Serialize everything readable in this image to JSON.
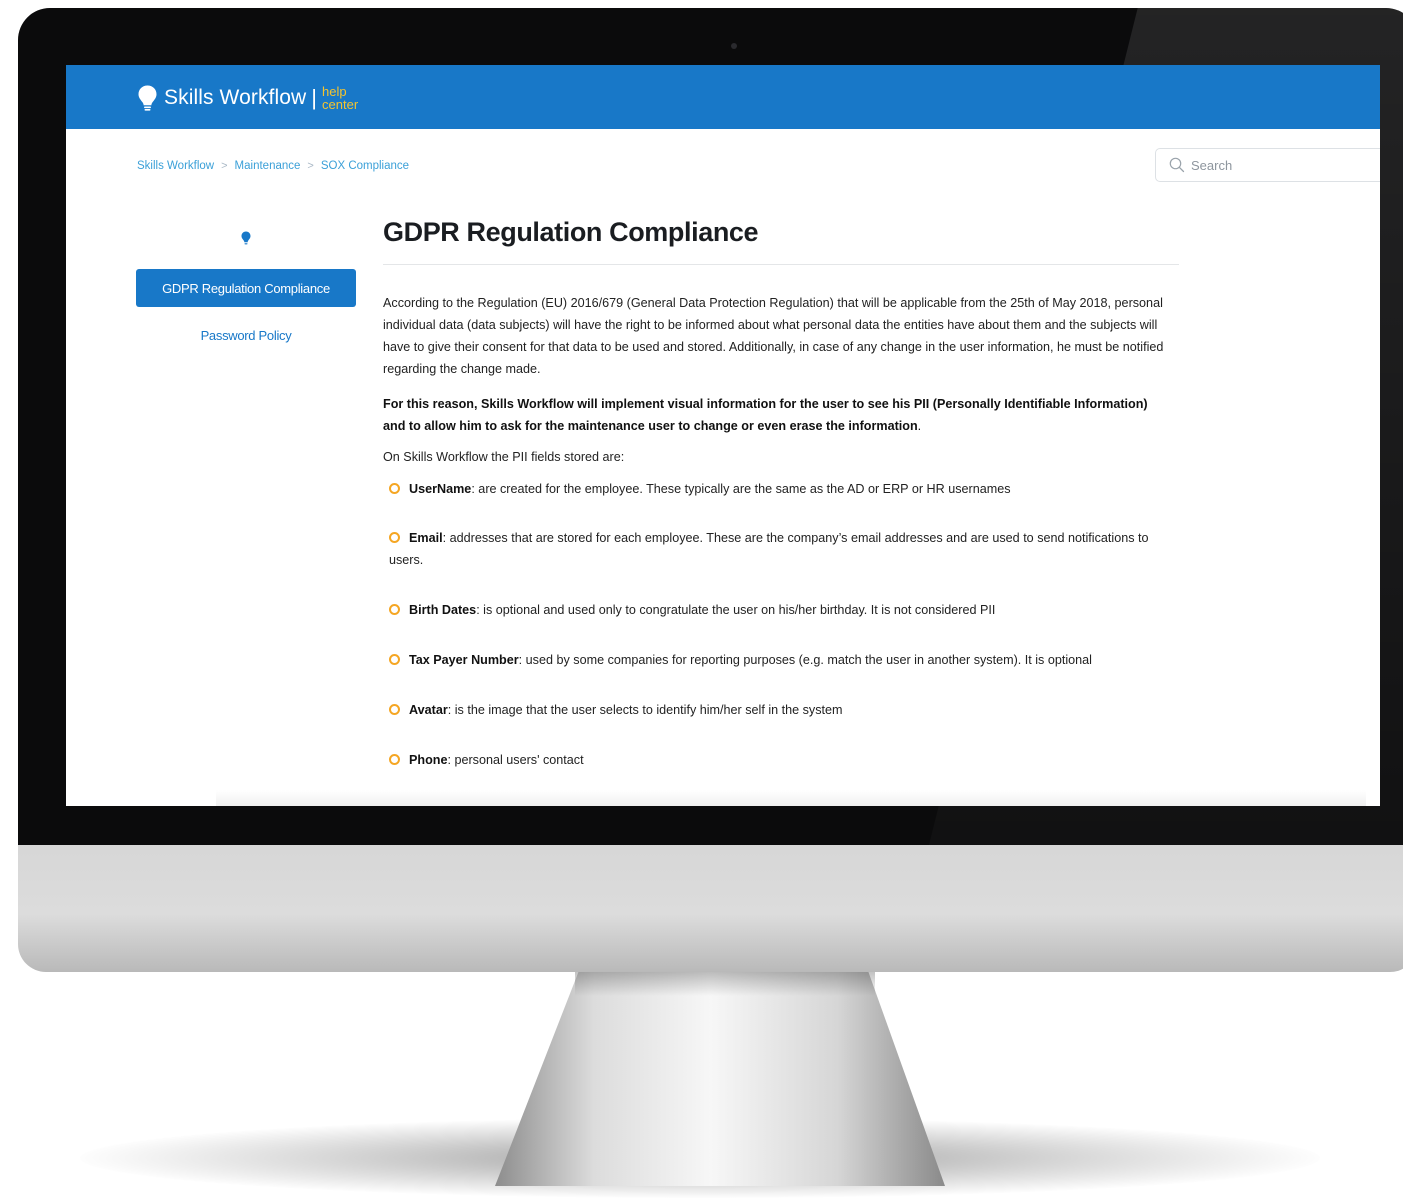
{
  "header": {
    "brand_name": "Skills Workflow",
    "brand_sub_line1": "help",
    "brand_sub_line2": "center",
    "brand_color": "#1878c8",
    "accent_color": "#f4c430"
  },
  "breadcrumb": {
    "items": [
      "Skills Workflow",
      "Maintenance",
      "SOX Compliance"
    ],
    "separator": ">"
  },
  "search": {
    "placeholder": "Search",
    "value": ""
  },
  "sidebar": {
    "icon": "lightbulb-pin-icon",
    "items": [
      {
        "label": "GDPR Regulation Compliance",
        "active": true
      },
      {
        "label": "Password Policy",
        "active": false
      }
    ]
  },
  "article": {
    "title": "GDPR Regulation Compliance",
    "paragraph1": "According to the Regulation (EU) 2016/679 (General Data Protection Regulation) that will be applicable from the 25th of May 2018, personal individual data (data subjects) will have the right to be informed about what personal data the entities have about them and the subjects will have to give their consent for that data to be used and stored. Additionally, in case of any change in the user information, he must be notified regarding the change made.",
    "paragraph2_bold": "For this reason, Skills Workflow will implement visual information for the user to see his PII (Personally Identifiable Information) and to allow him to ask for the maintenance user to change or even erase the information",
    "paragraph2_end": ".",
    "fields_intro": "On Skills Workflow the PII fields stored are:",
    "bullet_color": "#f5a623",
    "fields": [
      {
        "name": "UserName",
        "desc": ": are created for the employee. These typically are the same as the AD or ERP or HR usernames"
      },
      {
        "name": "Email",
        "desc": ": addresses that are stored for each employee. These are the company’s email addresses and are used to send notifications to users."
      },
      {
        "name": "Birth Dates",
        "desc": ": is optional and used only to congratulate the user on his/her birthday. It is not considered PII"
      },
      {
        "name": "Tax Payer Number",
        "desc": ": used by some companies for reporting purposes (e.g. match the user in another system). It is optional"
      },
      {
        "name": "Avatar",
        "desc": ": is the image that the user selects to identify him/her self in the system"
      },
      {
        "name": "Phone",
        "desc": ": personal users' contact"
      }
    ]
  }
}
